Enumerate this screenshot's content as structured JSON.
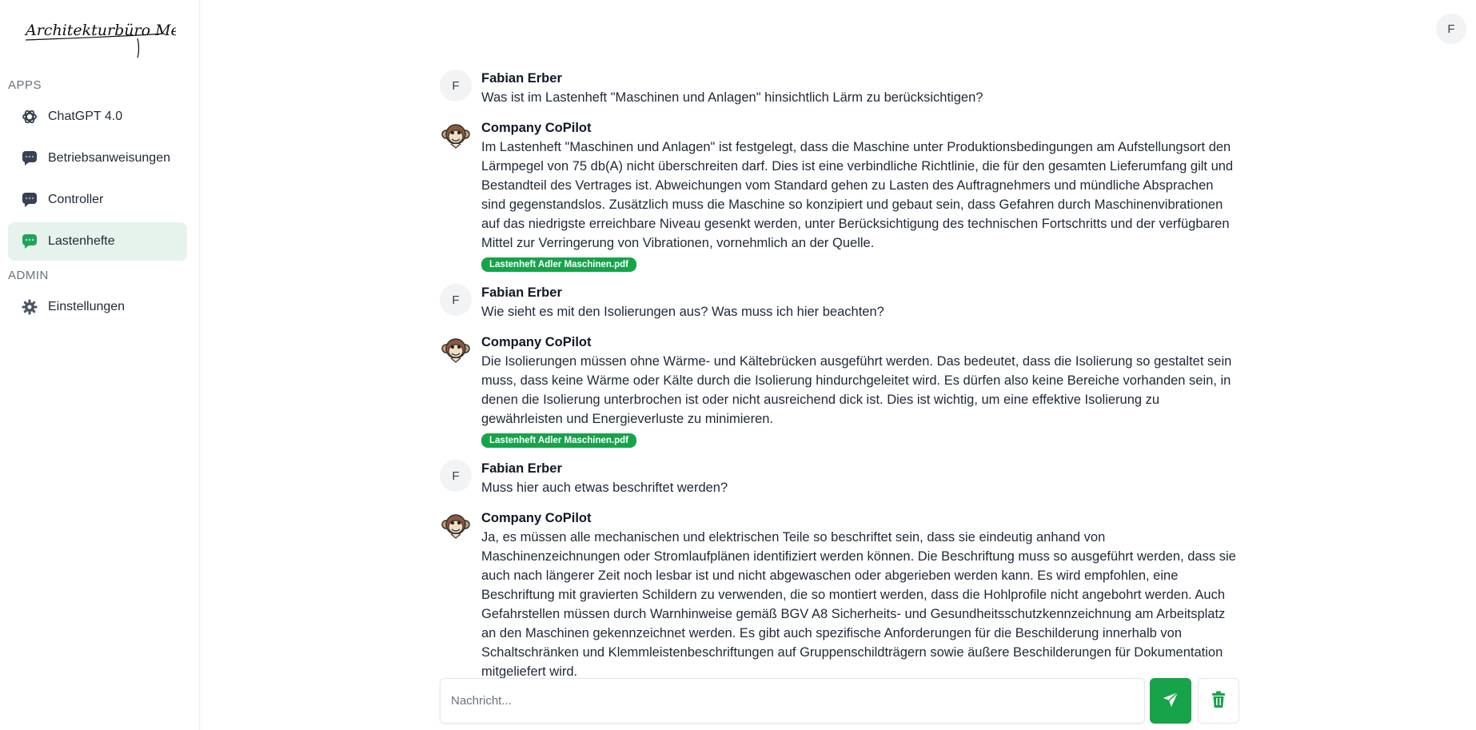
{
  "brand": {
    "logo_text": "Architekturbüro Meier"
  },
  "sidebar": {
    "apps_label": "APPS",
    "admin_label": "ADMIN",
    "items": [
      {
        "label": "ChatGPT 4.0",
        "icon": "openai-icon"
      },
      {
        "label": "Betriebsanweisungen",
        "icon": "chat-bubble-icon"
      },
      {
        "label": "Controller",
        "icon": "chat-bubble-icon"
      },
      {
        "label": "Lastenhefte",
        "icon": "chat-bubble-icon",
        "active": true
      }
    ],
    "admin_items": [
      {
        "label": "Einstellungen",
        "icon": "gear-icon"
      }
    ]
  },
  "user": {
    "initial": "F"
  },
  "messages": [
    {
      "author": "Fabian Erber",
      "role": "user",
      "avatar": "F",
      "text": "Was ist im Lastenheft \"Maschinen und Anlagen\" hinsichtlich Lärm zu berücksichtigen?"
    },
    {
      "author": "Company CoPilot",
      "role": "bot",
      "text": "Im Lastenheft \"Maschinen und Anlagen\" ist festgelegt, dass die Maschine unter Produktionsbedingungen am Aufstellungsort den Lärmpegel von 75 db(A) nicht überschreiten darf. Dies ist eine verbindliche Richtlinie, die für den gesamten Lieferumfang gilt und Bestandteil des Vertrages ist. Abweichungen vom Standard gehen zu Lasten des Auftragnehmers und mündliche Absprachen sind gegenstandslos. Zusätzlich muss die Maschine so konzipiert und gebaut sein, dass Gefahren durch Maschinenvibrationen auf das niedrigste erreichbare Niveau gesenkt werden, unter Berücksichtigung des technischen Fortschritts und der verfügbaren Mittel zur Verringerung von Vibrationen, vornehmlich an der Quelle.",
      "source": "Lastenheft Adler Maschinen.pdf"
    },
    {
      "author": "Fabian Erber",
      "role": "user",
      "avatar": "F",
      "text": "Wie sieht es mit den Isolierungen aus? Was muss ich hier beachten?"
    },
    {
      "author": "Company CoPilot",
      "role": "bot",
      "text": "Die Isolierungen müssen ohne Wärme- und Kältebrücken ausgeführt werden. Das bedeutet, dass die Isolierung so gestaltet sein muss, dass keine Wärme oder Kälte durch die Isolierung hindurchgeleitet wird. Es dürfen also keine Bereiche vorhanden sein, in denen die Isolierung unterbrochen ist oder nicht ausreichend dick ist. Dies ist wichtig, um eine effektive Isolierung zu gewährleisten und Energieverluste zu minimieren.",
      "source": "Lastenheft Adler Maschinen.pdf"
    },
    {
      "author": "Fabian Erber",
      "role": "user",
      "avatar": "F",
      "text": "Muss hier auch etwas beschriftet werden?"
    },
    {
      "author": "Company CoPilot",
      "role": "bot",
      "text": "Ja, es müssen alle mechanischen und elektrischen Teile so beschriftet sein, dass sie eindeutig anhand von Maschinenzeichnungen oder Stromlaufplänen identifiziert werden können. Die Beschriftung muss so ausgeführt werden, dass sie auch nach längerer Zeit noch lesbar ist und nicht abgewaschen oder abgerieben werden kann. Es wird empfohlen, eine Beschriftung mit gravierten Schildern zu verwenden, die so montiert werden, dass die Hohlprofile nicht angebohrt werden. Auch Gefahrstellen müssen durch Warnhinweise gemäß BGV A8 Sicherheits- und Gesundheitsschutzkennzeichnung am Arbeitsplatz an den Maschinen gekennzeichnet werden. Es gibt auch spezifische Anforderungen für die Beschilderung innerhalb von Schaltschränken und Klemmleistenbeschriftungen auf Gruppenschildträgern sowie äußere Beschilderungen für Dokumentation mitgeliefert wird."
    }
  ],
  "composer": {
    "placeholder": "Nachricht..."
  },
  "colors": {
    "accent": "#16a34a",
    "active_bg": "#e6f3ec"
  }
}
